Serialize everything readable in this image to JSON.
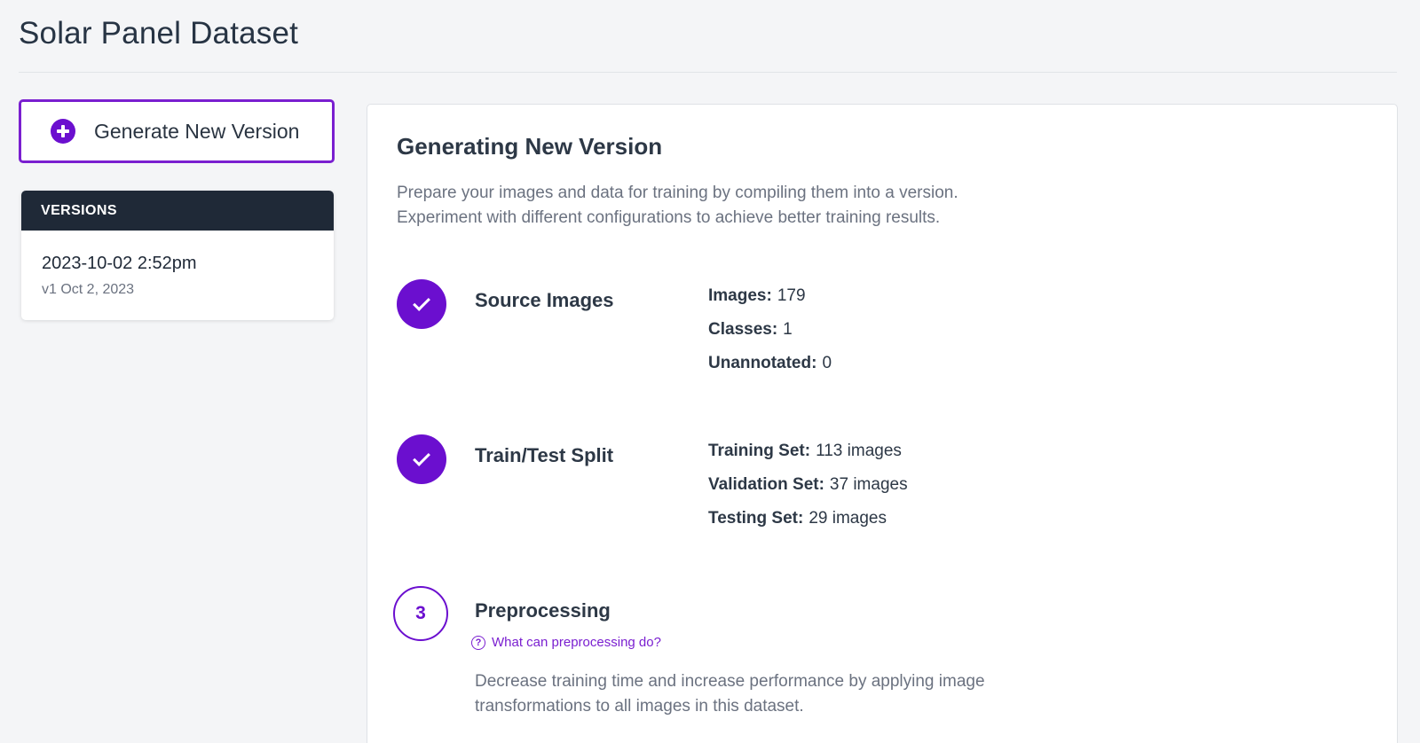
{
  "page": {
    "title": "Solar Panel Dataset"
  },
  "sidebar": {
    "generate_button": {
      "label": "Generate New Version",
      "icon": "plus-circle-icon"
    },
    "versions": {
      "header": "VERSIONS",
      "items": [
        {
          "date": "2023-10-02 2:52pm",
          "subtitle": "v1 Oct 2, 2023"
        }
      ]
    }
  },
  "main": {
    "title": "Generating New Version",
    "description_line1": "Prepare your images and data for training by compiling them into a version.",
    "description_line2": "Experiment with different configurations to achieve better training results.",
    "steps": [
      {
        "status": "complete",
        "icon": "check-icon",
        "title": "Source Images",
        "stats": [
          {
            "label": "Images:",
            "value": "179"
          },
          {
            "label": "Classes:",
            "value": "1"
          },
          {
            "label": "Unannotated:",
            "value": "0"
          }
        ]
      },
      {
        "status": "complete",
        "icon": "check-icon",
        "title": "Train/Test Split",
        "stats": [
          {
            "label": "Training Set:",
            "value": "113 images"
          },
          {
            "label": "Validation Set:",
            "value": "37 images"
          },
          {
            "label": "Testing Set:",
            "value": "29 images"
          }
        ]
      },
      {
        "status": "current",
        "number": "3",
        "title": "Preprocessing",
        "help_link": "What can preprocessing do?",
        "help_icon": "question-circle-icon",
        "description_line1": "Decrease training time and increase performance by applying image",
        "description_line2": "transformations to all images in this dataset."
      }
    ]
  },
  "colors": {
    "accent": "#6b0fcf",
    "header_dark": "#1f2937",
    "background": "#f4f5f7"
  }
}
